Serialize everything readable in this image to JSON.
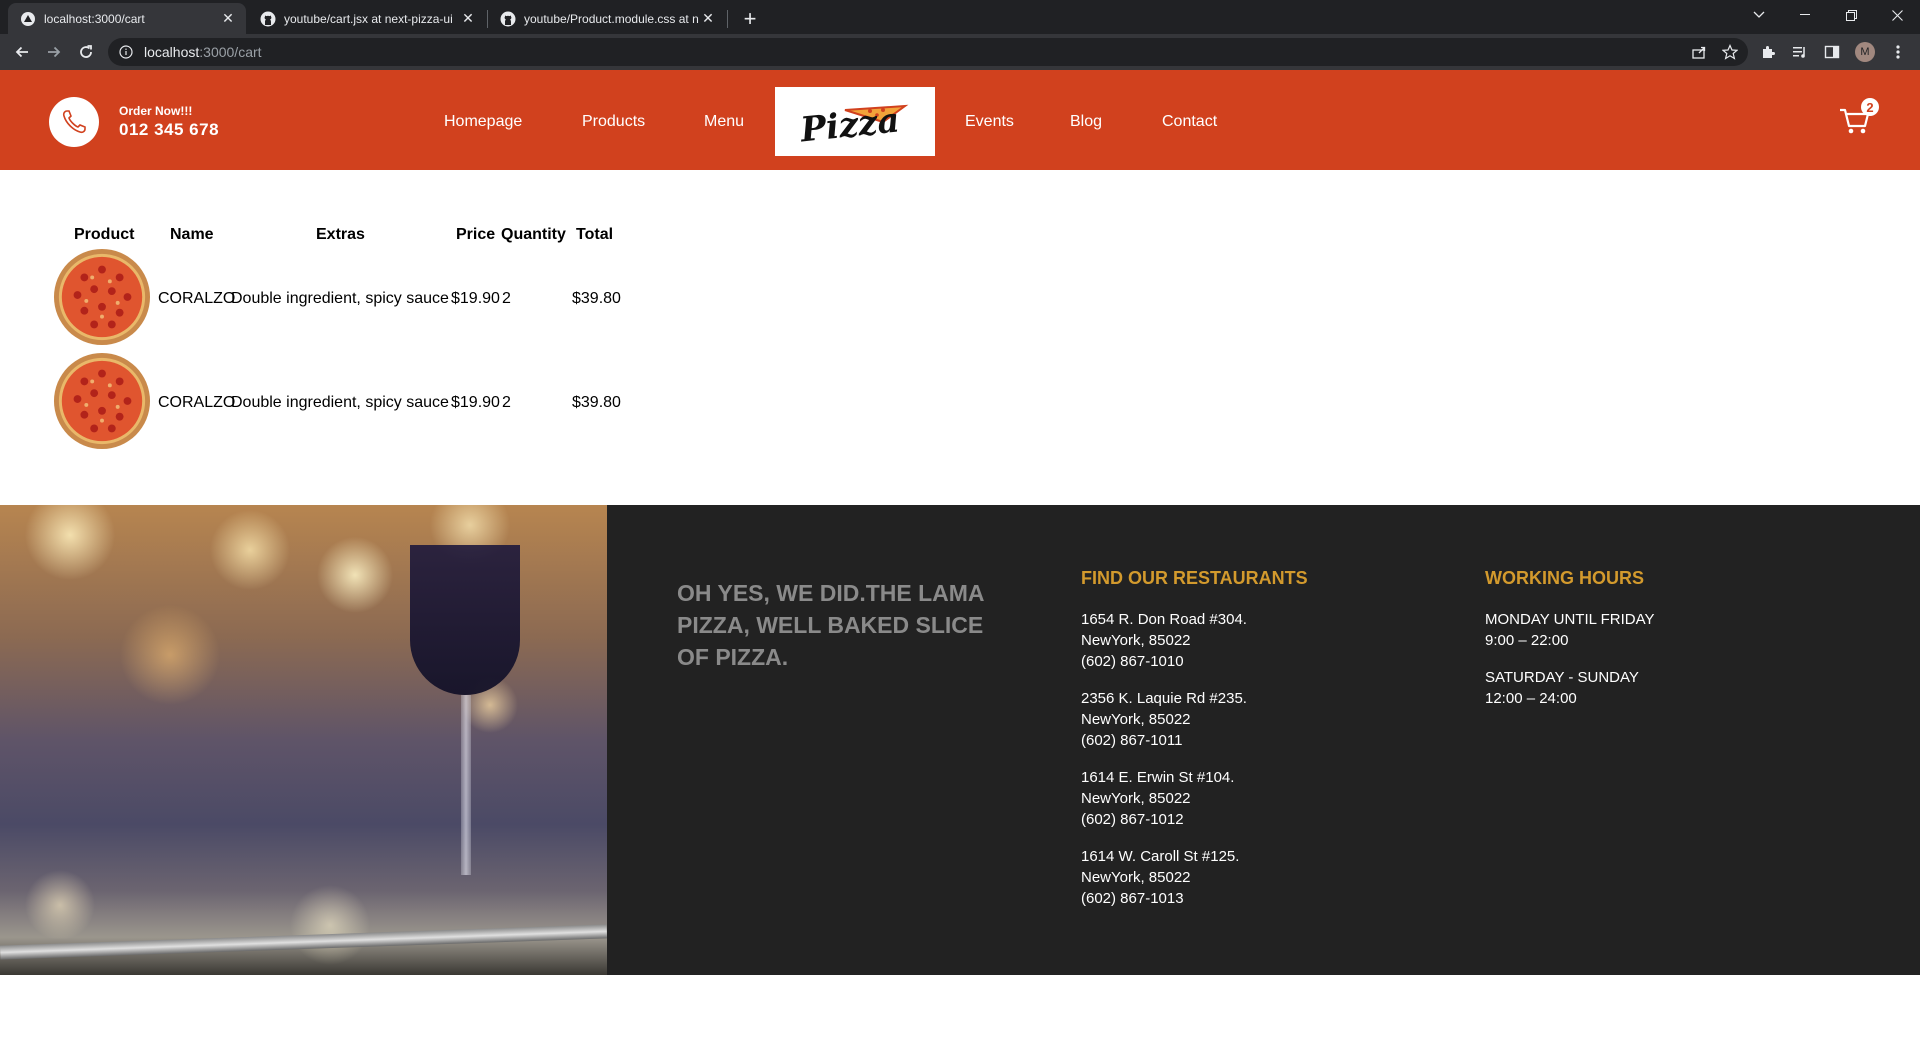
{
  "browser": {
    "tabs": [
      {
        "title": "localhost:3000/cart",
        "active": true
      },
      {
        "title": "youtube/cart.jsx at next-pizza-ui",
        "active": false
      },
      {
        "title": "youtube/Product.module.css at n",
        "active": false
      }
    ],
    "address": {
      "host": "localhost",
      "path": ":3000/cart"
    },
    "profile_initial": "M"
  },
  "navbar": {
    "order_label": "Order Now!!!",
    "phone": "012 345 678",
    "links": [
      "Homepage",
      "Products",
      "Menu",
      "Events",
      "Blog",
      "Contact"
    ],
    "logo_text": "Pizza",
    "cart_count": "2",
    "colors": {
      "accent": "#d1411e"
    }
  },
  "cart": {
    "headers": [
      "Product",
      "Name",
      "Extras",
      "Price",
      "Quantity",
      "Total"
    ],
    "rows": [
      {
        "name": "CORALZO",
        "extras": "Double ingredient, spicy sauce",
        "price": "$19.90",
        "quantity": "2",
        "total": "$39.80"
      },
      {
        "name": "CORALZO",
        "extras": "Double ingredient, spicy sauce",
        "price": "$19.90",
        "quantity": "2",
        "total": "$39.80"
      }
    ]
  },
  "footer": {
    "slogan": "OH YES, WE DID.THE LAMA PIZZA, WELL BAKED SLICE OF PIZZA.",
    "restaurants_title": "FIND OUR RESTAURANTS",
    "restaurants": [
      {
        "street": "1654 R. Don Road #304.",
        "city": "NewYork, 85022",
        "phone": "(602) 867-1010"
      },
      {
        "street": "2356 K. Laquie Rd #235.",
        "city": "NewYork, 85022",
        "phone": "(602) 867-1011"
      },
      {
        "street": "1614 E. Erwin St #104.",
        "city": "NewYork, 85022",
        "phone": "(602) 867-1012"
      },
      {
        "street": "1614 W. Caroll St #125.",
        "city": "NewYork, 85022",
        "phone": "(602) 867-1013"
      }
    ],
    "hours_title": "WORKING HOURS",
    "hours": [
      {
        "days": "MONDAY UNTIL FRIDAY",
        "time": "9:00 – 22:00"
      },
      {
        "days": "SATURDAY - SUNDAY",
        "time": "12:00 – 24:00"
      }
    ],
    "colors": {
      "title": "#d39a2d",
      "background": "#222222"
    }
  }
}
